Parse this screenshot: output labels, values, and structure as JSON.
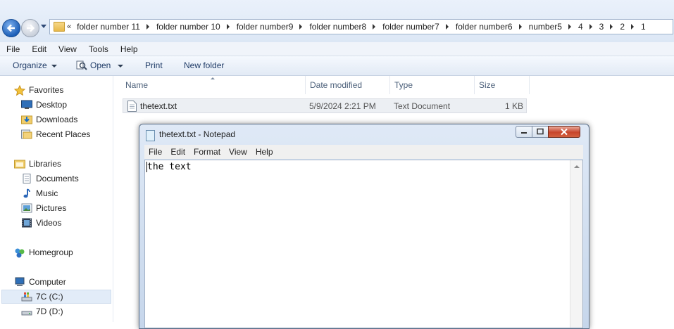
{
  "addressbar": {
    "overflow_glyph": "«",
    "crumbs": [
      "folder number 11",
      "folder number 10",
      "folder number9",
      "folder number8",
      "folder number7",
      "folder number6",
      "number5",
      "4",
      "3",
      "2",
      "1"
    ]
  },
  "menubar": {
    "items": [
      "File",
      "Edit",
      "View",
      "Tools",
      "Help"
    ]
  },
  "toolbar": {
    "organize": "Organize",
    "open": "Open",
    "print": "Print",
    "new_folder": "New folder"
  },
  "navpane": {
    "favorites": "Favorites",
    "desktop": "Desktop",
    "downloads": "Downloads",
    "recent_places": "Recent Places",
    "libraries": "Libraries",
    "documents": "Documents",
    "music": "Music",
    "pictures": "Pictures",
    "videos": "Videos",
    "homegroup": "Homegroup",
    "computer": "Computer",
    "drive_c": "7C (C:)",
    "drive_d": "7D (D:)"
  },
  "filelist": {
    "columns": [
      "Name",
      "Date modified",
      "Type",
      "Size"
    ],
    "rows": [
      {
        "name": "thetext.txt",
        "date": "5/9/2024 2:21 PM",
        "type": "Text Document",
        "size": "1 KB"
      }
    ]
  },
  "notepad": {
    "title": "thetext.txt - Notepad",
    "menu": [
      "File",
      "Edit",
      "Format",
      "View",
      "Help"
    ],
    "content": "the text"
  }
}
